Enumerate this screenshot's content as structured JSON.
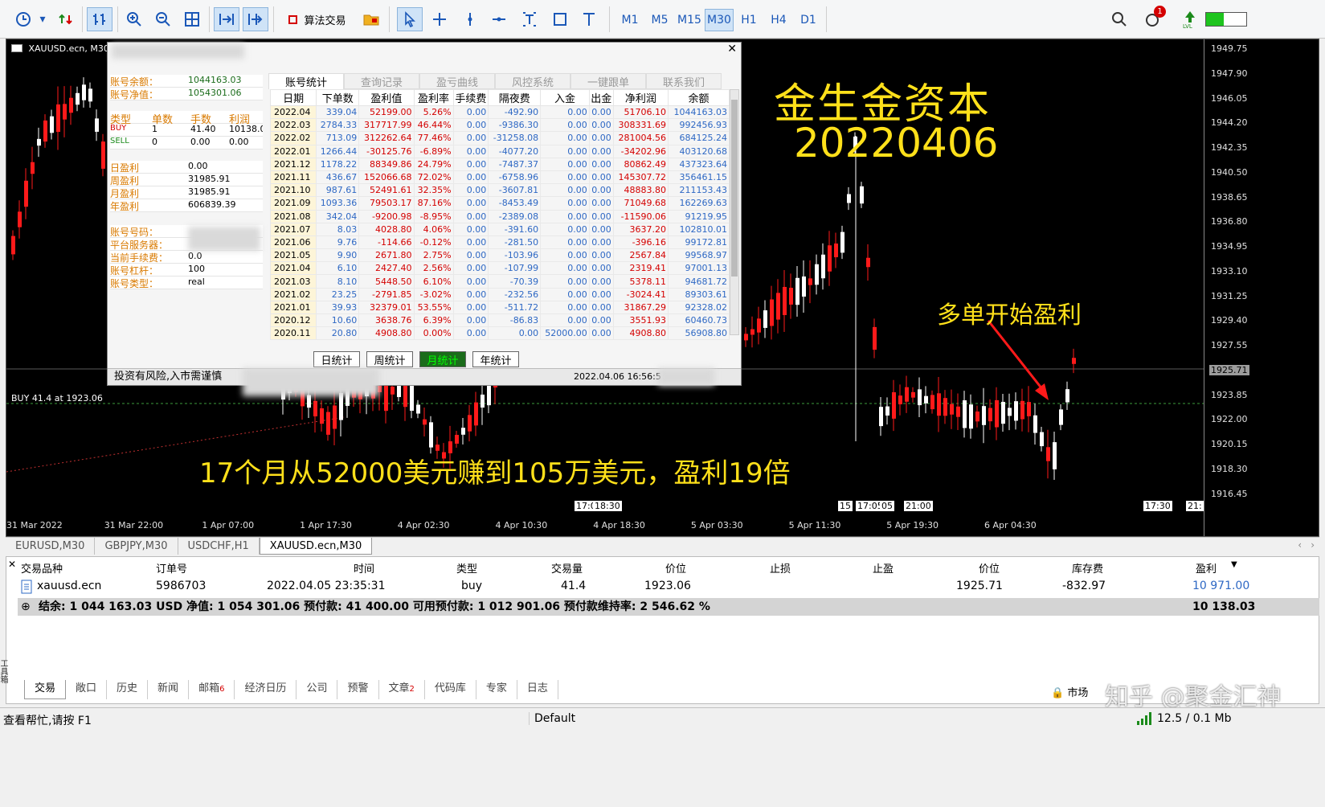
{
  "toolbar": {
    "algo_trading_label": "算法交易",
    "timeframes": [
      "M1",
      "M5",
      "M15",
      "M30",
      "H1",
      "H4",
      "D1"
    ],
    "active_timeframe": "M30",
    "notification_count": "1"
  },
  "chart": {
    "symbol_title": "XAUUSD.ecn, M30",
    "overlay_title": "金生金资本",
    "overlay_date": "20220406",
    "overlay_profit": "多单开始盈利",
    "overlay_bottom": "17个月从52000美元赚到105万美元，盈利19倍",
    "buy_line_label": "BUY 41.4 at 1923.06",
    "price_labels": [
      "1949.75",
      "1947.90",
      "1946.05",
      "1944.20",
      "1942.35",
      "1940.50",
      "1938.65",
      "1936.80",
      "1934.95",
      "1933.10",
      "1931.25",
      "1929.40",
      "1927.55",
      "1925.71",
      "1923.85",
      "1922.00",
      "1920.15",
      "1918.30",
      "1916.45"
    ],
    "current_price": "1925.71",
    "time_labels": [
      "31 Mar 2022",
      "31 Mar 22:00",
      "1 Apr 07:00",
      "1 Apr 17:30",
      "4 Apr 02:30",
      "4 Apr 10:30",
      "4 Apr 18:30",
      "5 Apr 03:30",
      "5 Apr 11:30",
      "5 Apr 19:30",
      "6 Apr 04:30"
    ],
    "marker_labels": [
      "17:0",
      "18:30",
      "15",
      "17:05",
      "05",
      "21:00",
      "17:30",
      "21:"
    ]
  },
  "dialog": {
    "balance_label": "账号余额：",
    "balance": "1044163.03",
    "equity_label": "账号净值：",
    "equity": "1054301.06",
    "pos_headers": [
      "类型",
      "单数",
      "手数",
      "利润"
    ],
    "pos_rows": [
      [
        "BUY",
        "1",
        "41.40",
        "10138.0"
      ],
      [
        "SELL",
        "0",
        "0.00",
        "0.00"
      ]
    ],
    "period_rows": [
      [
        "日盈利",
        "0.00"
      ],
      [
        "周盈利",
        "31985.91"
      ],
      [
        "月盈利",
        "31985.91"
      ],
      [
        "年盈利",
        "606839.39"
      ]
    ],
    "account_rows": [
      [
        "账号号码：",
        ""
      ],
      [
        "平台服务器：",
        ""
      ],
      [
        "当前手续费：",
        "0.0"
      ],
      [
        "账号杠杆：",
        "100"
      ],
      [
        "账号类型：",
        "real"
      ]
    ],
    "tabs": [
      "账号统计",
      "查询记录",
      "盈亏曲线",
      "风控系统",
      "一键跟单",
      "联系我们"
    ],
    "table_headers": [
      "日期",
      "下单数",
      "盈利值",
      "盈利率",
      "手续费",
      "隔夜费",
      "入金",
      "出金",
      "净利润",
      "余额"
    ],
    "table_rows": [
      [
        "2022.04",
        "339.04",
        "52199.00",
        "5.26%",
        "0.00",
        "-492.90",
        "0.00",
        "0.00",
        "51706.10",
        "1044163.03"
      ],
      [
        "2022.03",
        "2784.33",
        "317717.99",
        "46.44%",
        "0.00",
        "-9386.30",
        "0.00",
        "0.00",
        "308331.69",
        "992456.93"
      ],
      [
        "2022.02",
        "713.09",
        "312262.64",
        "77.46%",
        "0.00",
        "-31258.08",
        "0.00",
        "0.00",
        "281004.56",
        "684125.24"
      ],
      [
        "2022.01",
        "1266.44",
        "-30125.76",
        "-6.89%",
        "0.00",
        "-4077.20",
        "0.00",
        "0.00",
        "-34202.96",
        "403120.68"
      ],
      [
        "2021.12",
        "1178.22",
        "88349.86",
        "24.79%",
        "0.00",
        "-7487.37",
        "0.00",
        "0.00",
        "80862.49",
        "437323.64"
      ],
      [
        "2021.11",
        "436.67",
        "152066.68",
        "72.02%",
        "0.00",
        "-6758.96",
        "0.00",
        "0.00",
        "145307.72",
        "356461.15"
      ],
      [
        "2021.10",
        "987.61",
        "52491.61",
        "32.35%",
        "0.00",
        "-3607.81",
        "0.00",
        "0.00",
        "48883.80",
        "211153.43"
      ],
      [
        "2021.09",
        "1093.36",
        "79503.17",
        "87.16%",
        "0.00",
        "-8453.49",
        "0.00",
        "0.00",
        "71049.68",
        "162269.63"
      ],
      [
        "2021.08",
        "342.04",
        "-9200.98",
        "-8.95%",
        "0.00",
        "-2389.08",
        "0.00",
        "0.00",
        "-11590.06",
        "91219.95"
      ],
      [
        "2021.07",
        "8.03",
        "4028.80",
        "4.06%",
        "0.00",
        "-391.60",
        "0.00",
        "0.00",
        "3637.20",
        "102810.01"
      ],
      [
        "2021.06",
        "9.76",
        "-114.66",
        "-0.12%",
        "0.00",
        "-281.50",
        "0.00",
        "0.00",
        "-396.16",
        "99172.81"
      ],
      [
        "2021.05",
        "9.90",
        "2671.80",
        "2.75%",
        "0.00",
        "-103.96",
        "0.00",
        "0.00",
        "2567.84",
        "99568.97"
      ],
      [
        "2021.04",
        "6.10",
        "2427.40",
        "2.56%",
        "0.00",
        "-107.99",
        "0.00",
        "0.00",
        "2319.41",
        "97001.13"
      ],
      [
        "2021.03",
        "8.10",
        "5448.50",
        "6.10%",
        "0.00",
        "-70.39",
        "0.00",
        "0.00",
        "5378.11",
        "94681.72"
      ],
      [
        "2021.02",
        "23.25",
        "-2791.85",
        "-3.02%",
        "0.00",
        "-232.56",
        "0.00",
        "0.00",
        "-3024.41",
        "89303.61"
      ],
      [
        "2021.01",
        "39.93",
        "32379.01",
        "53.55%",
        "0.00",
        "-511.72",
        "0.00",
        "0.00",
        "31867.29",
        "92328.02"
      ],
      [
        "2020.12",
        "10.60",
        "3638.76",
        "6.39%",
        "0.00",
        "-86.83",
        "0.00",
        "0.00",
        "3551.93",
        "60460.73"
      ],
      [
        "2020.11",
        "20.80",
        "4908.80",
        "0.00%",
        "0.00",
        "0.00",
        "52000.00",
        "0.00",
        "4908.80",
        "56908.80"
      ]
    ],
    "stat_buttons": [
      "日统计",
      "周统计",
      "月统计",
      "年统计"
    ],
    "active_stat_button": "月统计",
    "footer_text": "投资有风险,入市需谨慎",
    "footer_time": "2022.04.06 16:56:5"
  },
  "symbol_tabs": [
    "EURUSD,M30",
    "GBPJPY,M30",
    "USDCHF,H1",
    "XAUUSD.ecn,M30"
  ],
  "terminal": {
    "headers": [
      "交易品种",
      "订单号",
      "时间",
      "类型",
      "交易量",
      "价位",
      "止损",
      "止盈",
      "价位",
      "库存费",
      "盈利"
    ],
    "row": [
      "xauusd.ecn",
      "5986703",
      "2022.04.05 23:35:31",
      "buy",
      "41.4",
      "1923.06",
      "",
      "",
      "1925.71",
      "-832.97",
      "10 971.00"
    ],
    "summary": "结余: 1 044 163.03 USD  净值: 1 054 301.06  预付款: 41 400.00  可用预付款: 1 012 901.06  预付款维持率: 2 546.62 %",
    "summary_total": "10 138.03",
    "bottom_tabs": [
      "交易",
      "敞口",
      "历史",
      "新闻",
      "邮箱",
      "经济日历",
      "公司",
      "预警",
      "文章",
      "代码库",
      "专家",
      "日志"
    ],
    "mail_count": "6",
    "article_count": "2",
    "market_label": "市场",
    "side_label": "工具箱"
  },
  "status": {
    "help": "查看帮忙,请按 F1",
    "profile": "Default",
    "speed": "12.5 / 0.1 Mb"
  },
  "watermark": "知乎 @聚金汇神"
}
